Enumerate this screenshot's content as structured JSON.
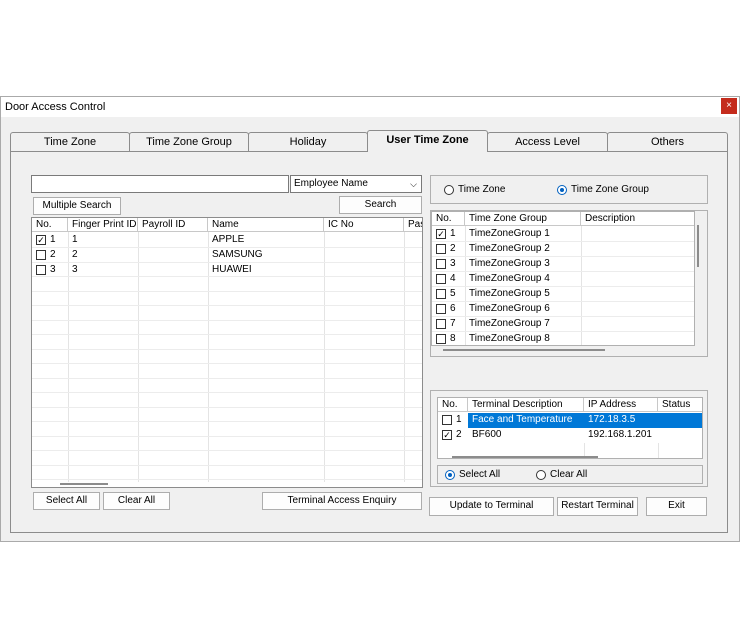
{
  "window": {
    "title": "Door Access Control",
    "close_icon": "close-icon"
  },
  "tabs": [
    {
      "label": "Time Zone"
    },
    {
      "label": "Time Zone Group"
    },
    {
      "label": "Holiday"
    },
    {
      "label": "User Time Zone"
    },
    {
      "label": "Access Level"
    },
    {
      "label": "Others"
    }
  ],
  "active_tab": "User Time Zone",
  "search": {
    "value": "",
    "field_select": "Employee Name",
    "multiple_search_label": "Multiple Search",
    "search_label": "Search"
  },
  "employee_grid": {
    "columns": [
      "No.",
      "Finger Print ID",
      "Payroll ID",
      "Name",
      "IC No",
      "Pas"
    ],
    "rows": [
      {
        "checked": true,
        "no": "1",
        "finger": "1",
        "payroll": "",
        "name": "APPLE",
        "ic": ""
      },
      {
        "checked": false,
        "no": "2",
        "finger": "2",
        "payroll": "",
        "name": "SAMSUNG",
        "ic": ""
      },
      {
        "checked": false,
        "no": "3",
        "finger": "3",
        "payroll": "",
        "name": "HUAWEI",
        "ic": ""
      }
    ]
  },
  "left_buttons": {
    "select_all": "Select All",
    "clear_all": "Clear All",
    "terminal_access_enquiry": "Terminal Access Enquiry"
  },
  "mode": {
    "time_zone_label": "Time Zone",
    "time_zone_group_label": "Time Zone Group",
    "selected": "Time Zone Group"
  },
  "tz_group_grid": {
    "columns": [
      "No.",
      "Time Zone Group",
      "Description"
    ],
    "rows": [
      {
        "checked": true,
        "no": "1",
        "name": "TimeZoneGroup 1"
      },
      {
        "checked": false,
        "no": "2",
        "name": "TimeZoneGroup 2"
      },
      {
        "checked": false,
        "no": "3",
        "name": "TimeZoneGroup 3"
      },
      {
        "checked": false,
        "no": "4",
        "name": "TimeZoneGroup 4"
      },
      {
        "checked": false,
        "no": "5",
        "name": "TimeZoneGroup 5"
      },
      {
        "checked": false,
        "no": "6",
        "name": "TimeZoneGroup 6"
      },
      {
        "checked": false,
        "no": "7",
        "name": "TimeZoneGroup 7"
      },
      {
        "checked": false,
        "no": "8",
        "name": "TimeZoneGroup 8"
      }
    ]
  },
  "terminal_grid": {
    "columns": [
      "No.",
      "Terminal Description",
      "IP Address",
      "Status"
    ],
    "rows": [
      {
        "checked": false,
        "no": "1",
        "desc": "Face and Temperature",
        "ip": "172.18.3.5",
        "status": "",
        "selected": true
      },
      {
        "checked": true,
        "no": "2",
        "desc": "BF600",
        "ip": "192.168.1.201",
        "status": "",
        "selected": false
      }
    ]
  },
  "terminal_select": {
    "select_all_label": "Select All",
    "clear_all_label": "Clear All",
    "selected": "Select All"
  },
  "right_buttons": {
    "update": "Update to Terminal",
    "restart": "Restart Terminal",
    "exit": "Exit"
  },
  "colors": {
    "selection": "#0078d7",
    "close": "#c42b1c"
  }
}
